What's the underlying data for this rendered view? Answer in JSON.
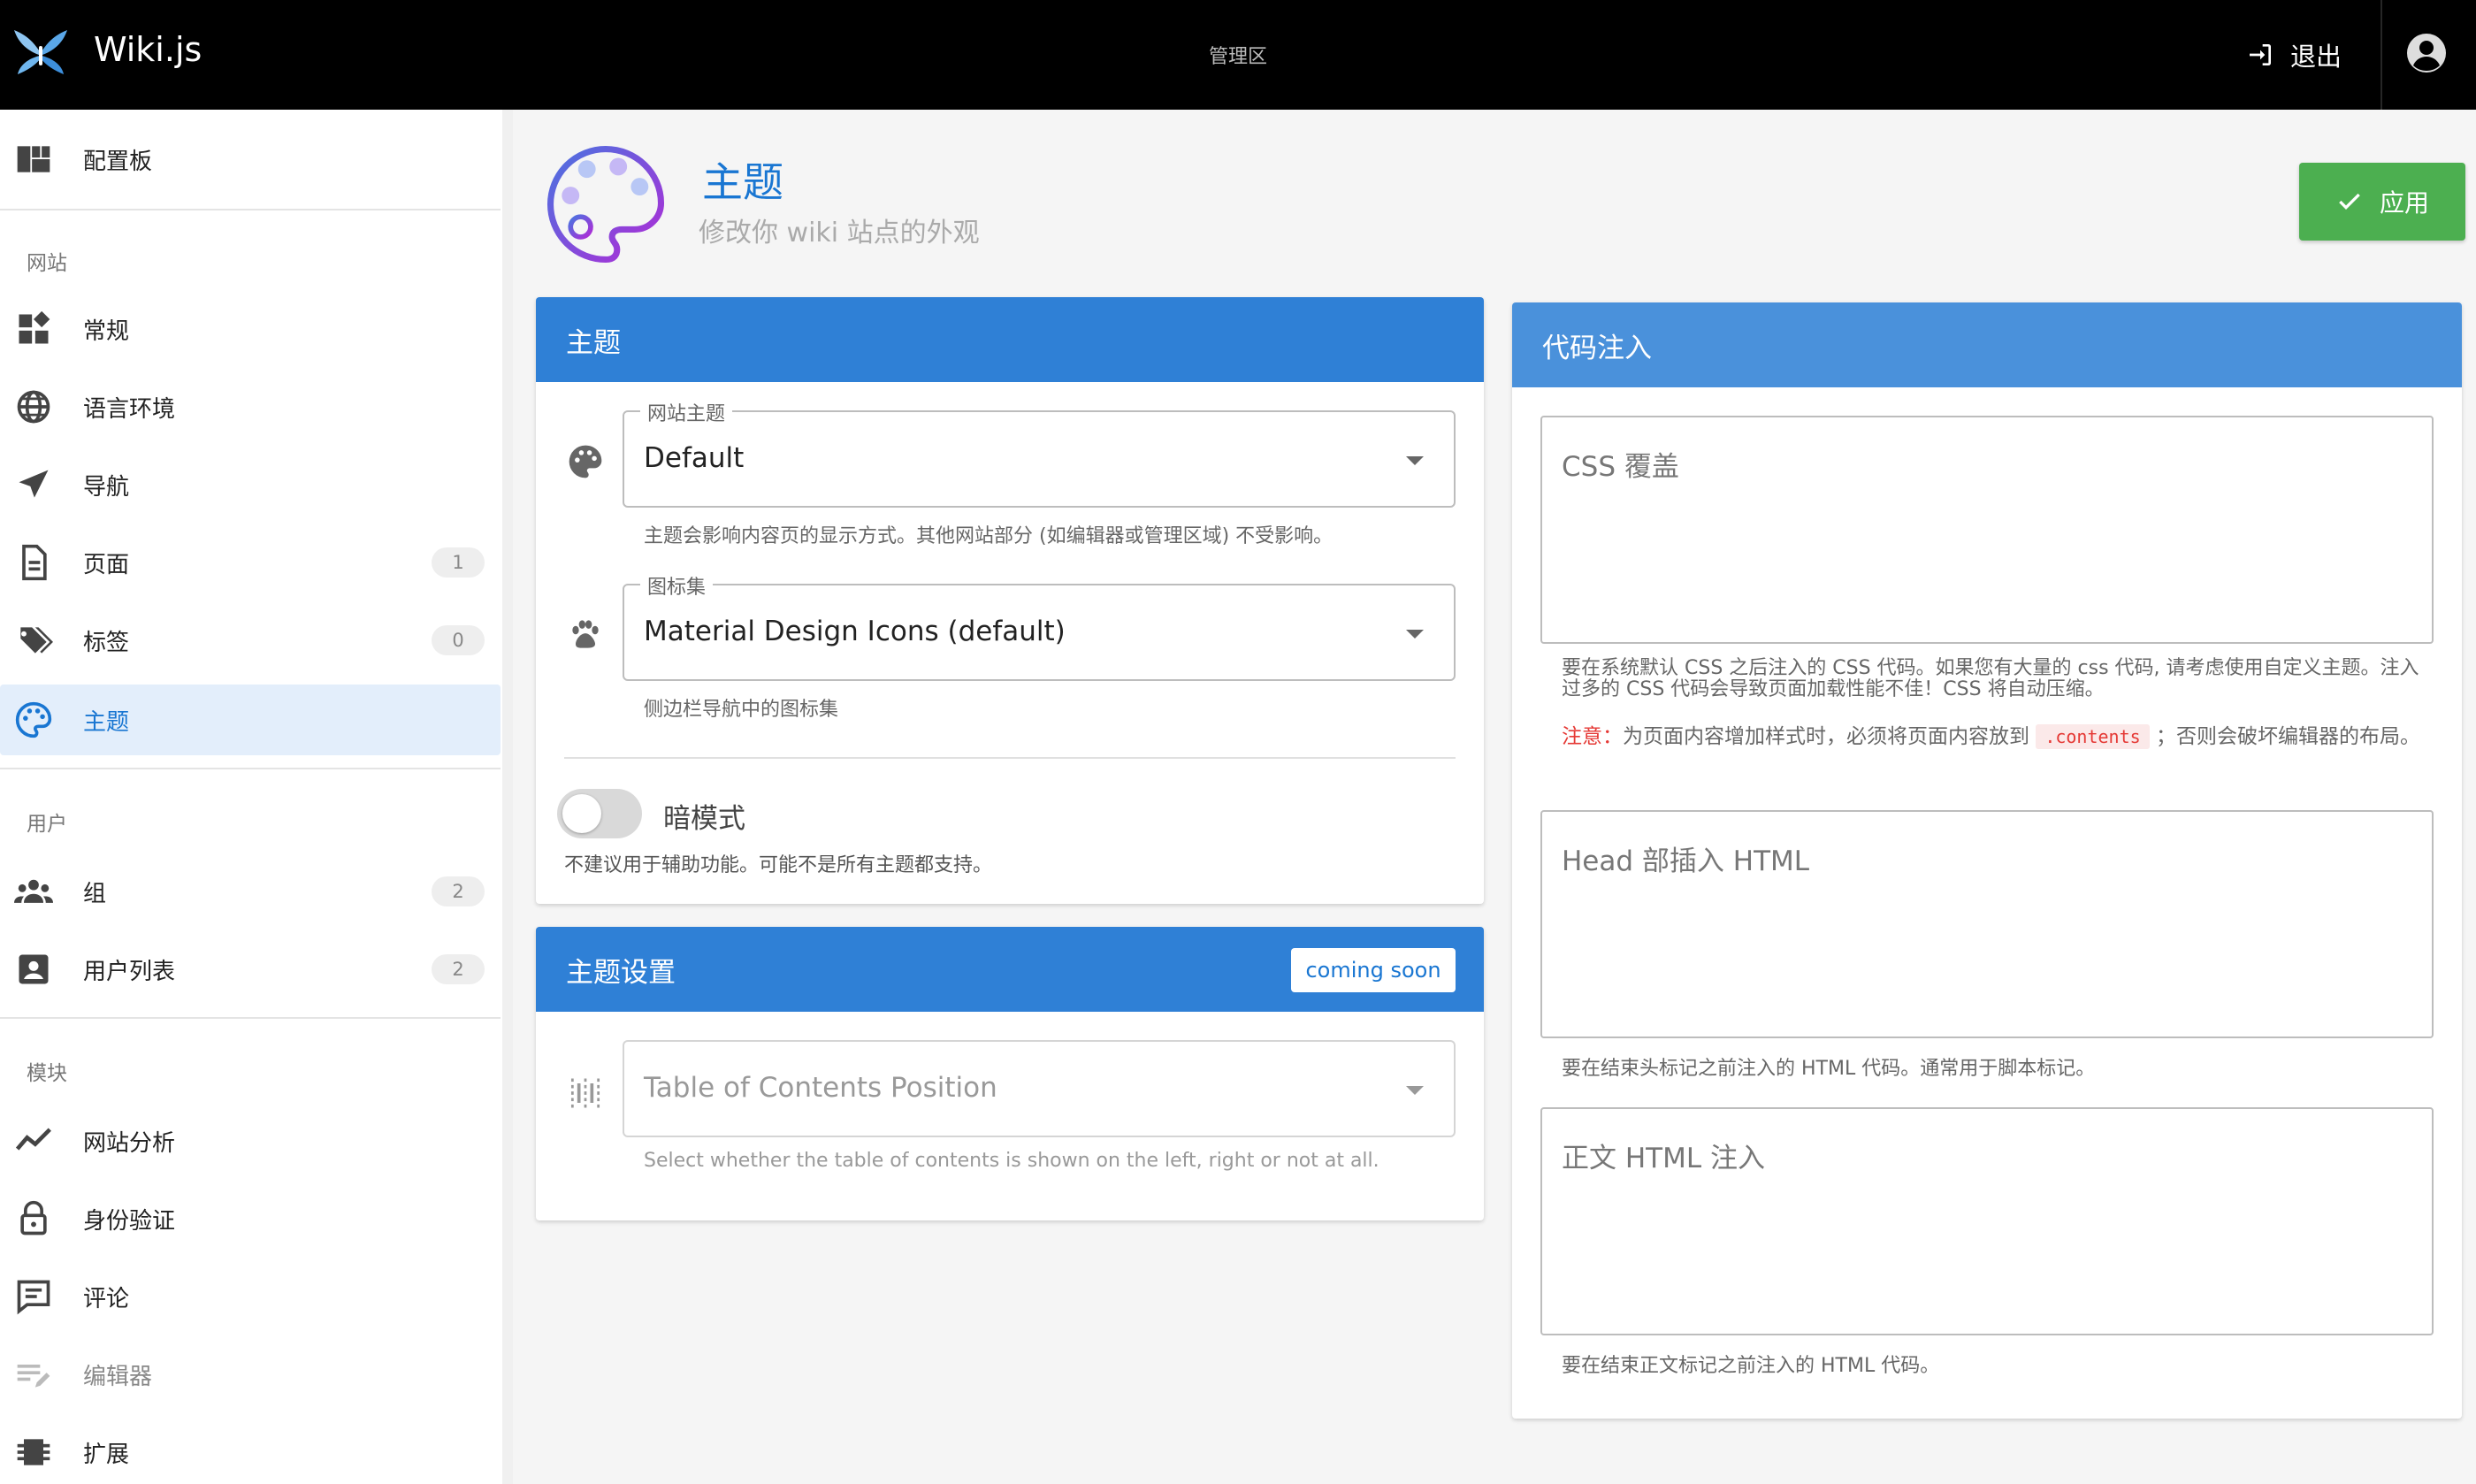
{
  "topbar": {
    "brand": "Wiki.js",
    "admin_area": "管理区",
    "logout": "退出"
  },
  "sidebar": {
    "dashboard": "配置板",
    "sections": {
      "site": "网站",
      "users": "用户",
      "modules": "模块"
    },
    "site_items": [
      {
        "label": "常规",
        "icon": "widgets-icon"
      },
      {
        "label": "语言环境",
        "icon": "globe-icon"
      },
      {
        "label": "导航",
        "icon": "navigation-icon"
      },
      {
        "label": "页面",
        "icon": "file-document-icon",
        "badge": "1"
      },
      {
        "label": "标签",
        "icon": "tags-icon",
        "badge": "0"
      },
      {
        "label": "主题",
        "icon": "palette-icon",
        "active": true
      }
    ],
    "user_items": [
      {
        "label": "组",
        "icon": "account-group-icon",
        "badge": "2"
      },
      {
        "label": "用户列表",
        "icon": "account-box-icon",
        "badge": "2"
      }
    ],
    "module_items": [
      {
        "label": "网站分析",
        "icon": "chart-line-icon"
      },
      {
        "label": "身份验证",
        "icon": "lock-icon"
      },
      {
        "label": "评论",
        "icon": "comment-icon"
      },
      {
        "label": "编辑器",
        "icon": "editor-icon"
      },
      {
        "label": "扩展",
        "icon": "extension-icon"
      }
    ]
  },
  "header": {
    "title": "主题",
    "subtitle": "修改你 wiki 站点的外观",
    "apply": "应用"
  },
  "theme_card": {
    "title": "主题",
    "site_theme": {
      "legend": "网站主题",
      "value": "Default",
      "hint": "主题会影响内容页的显示方式。其他网站部分 (如编辑器或管理区域) 不受影响。"
    },
    "icon_set": {
      "legend": "图标集",
      "value": "Material Design Icons (default)",
      "hint": "侧边栏导航中的图标集"
    },
    "dark_mode": {
      "label": "暗模式",
      "hint": "不建议用于辅助功能。可能不是所有主题都支持。",
      "enabled": false
    }
  },
  "theme_settings_card": {
    "title": "主题设置",
    "badge": "coming soon",
    "toc": {
      "placeholder": "Table of Contents Position",
      "hint": "Select whether the table of contents is shown on the left, right or not at all."
    }
  },
  "code_card": {
    "title": "代码注入",
    "css": {
      "placeholder": "CSS 覆盖",
      "hint": "要在系统默认 CSS 之后注入的 CSS 代码。如果您有大量的 css 代码, 请考虑使用自定义主题。注入过多的 CSS 代码会导致页面加载性能不佳！CSS 将自动压缩。",
      "warn_label": "注意：",
      "warn_text": "为页面内容增加样式时，必须将页面内容放到",
      "warn_code": ".contents",
      "warn_tail": "；否则会破坏编辑器的布局。"
    },
    "head": {
      "placeholder": "Head 部插入 HTML",
      "hint": "要在结束头标记之前注入的 HTML 代码。通常用于脚本标记。"
    },
    "body": {
      "placeholder": "正文 HTML 注入",
      "hint": "要在结束正文标记之前注入的 HTML 代码。"
    }
  },
  "colors": {
    "primary": "#1976d2",
    "card_header": "#2f80d6",
    "apply": "#4caf50",
    "topbar": "#000000"
  }
}
